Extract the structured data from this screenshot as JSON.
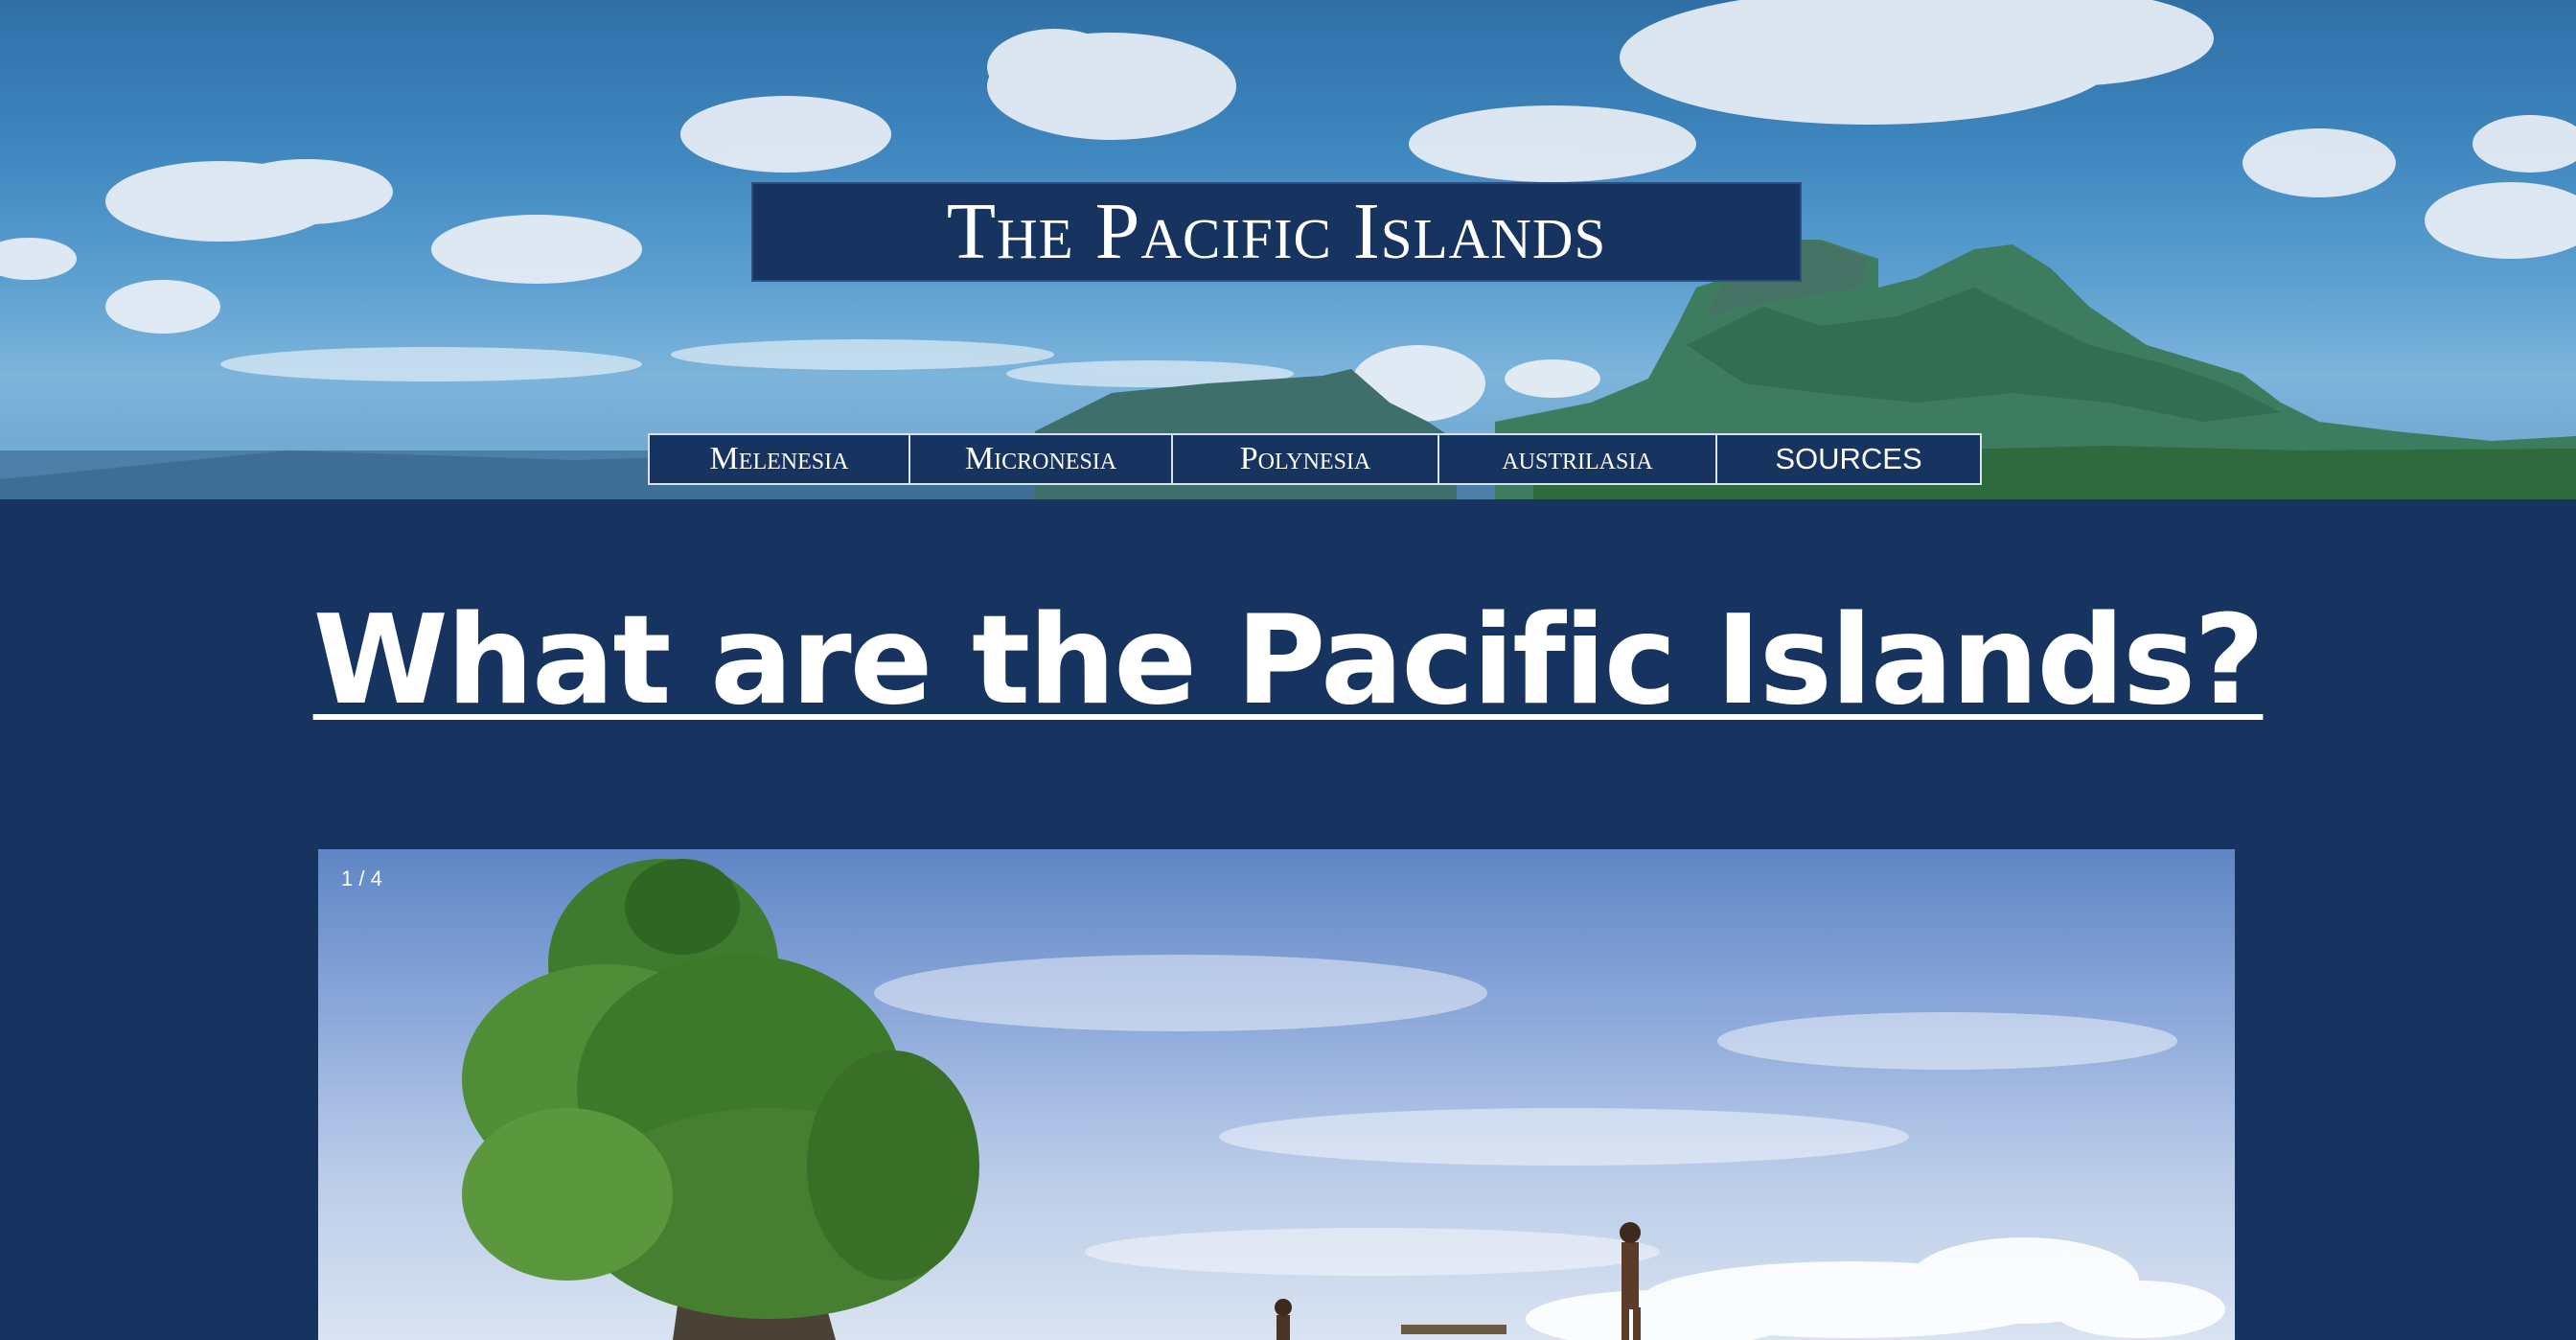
{
  "header": {
    "site_title": "The Pacific Islands",
    "nav": [
      {
        "label": "Melenesia"
      },
      {
        "label": "Micronesia"
      },
      {
        "label": "Polynesia"
      },
      {
        "label": "austrilasia"
      },
      {
        "label": "SOURCES"
      }
    ]
  },
  "main": {
    "heading": "What are the Pacific Islands?",
    "slideshow": {
      "counter": "1 / 4"
    }
  },
  "colors": {
    "page_background": "#173461",
    "nav_background": "#173461",
    "nav_border": "#d8e2ef",
    "text": "#ffffff"
  }
}
